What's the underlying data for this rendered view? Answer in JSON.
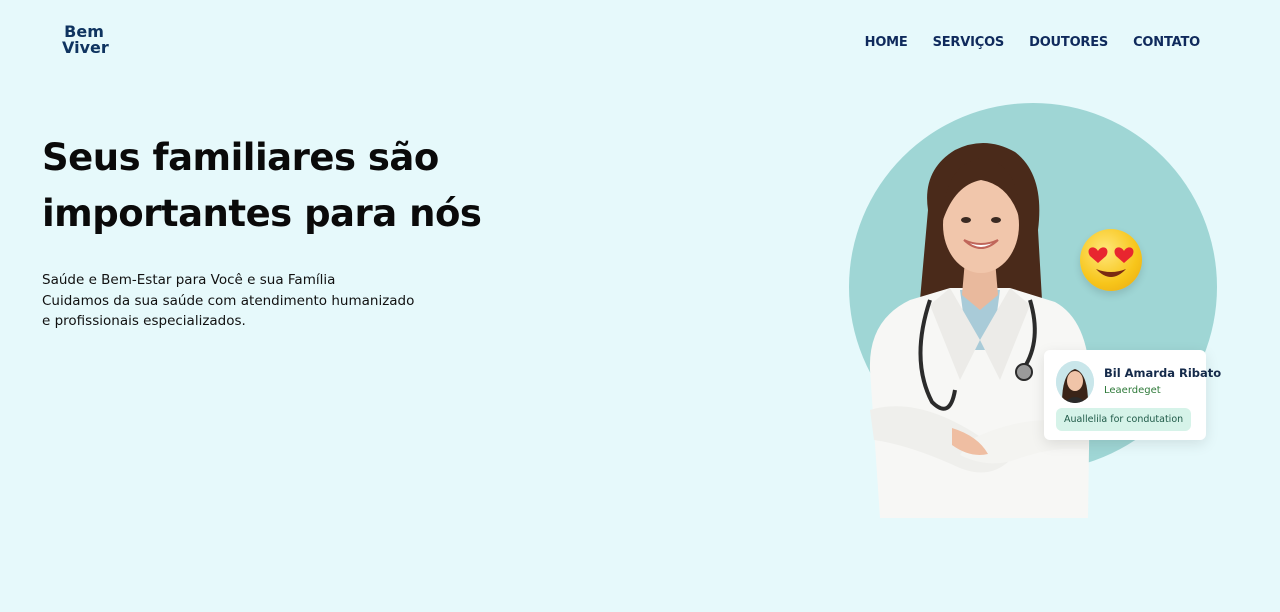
{
  "brand": {
    "line1": "Bem",
    "line2": "Viver"
  },
  "nav": {
    "items": [
      {
        "label": "HOME"
      },
      {
        "label": "SERVIÇOS"
      },
      {
        "label": "DOUTORES"
      },
      {
        "label": "CONTATO"
      }
    ]
  },
  "hero": {
    "title_line1": "Seus familiares são",
    "title_line2": "importantes para nós",
    "text_line1": "Saúde e Bem-Estar para Você e sua Família",
    "text_line2": "Cuidamos da sua saúde com atendimento humanizado",
    "text_line3": "e profissionais especializados."
  },
  "doctor_card": {
    "name": "Bil Amarda Ribato",
    "role": "Leaerdeget",
    "badge": "Auallelila for condutation"
  },
  "colors": {
    "background": "#e6f9fb",
    "circle": "#9fd6d5",
    "nav_text": "#0f2a5c",
    "badge_bg": "#d6f3e9"
  },
  "icons": {
    "emoji": "heart-eyes-emoji-icon"
  }
}
